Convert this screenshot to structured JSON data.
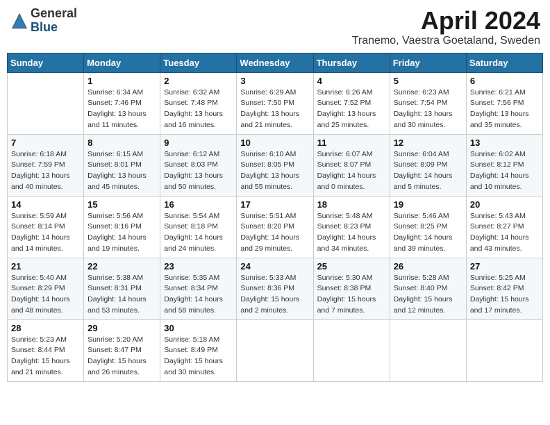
{
  "logo": {
    "general": "General",
    "blue": "Blue"
  },
  "title": "April 2024",
  "location": "Tranemo, Vaestra Goetaland, Sweden",
  "days_header": [
    "Sunday",
    "Monday",
    "Tuesday",
    "Wednesday",
    "Thursday",
    "Friday",
    "Saturday"
  ],
  "weeks": [
    [
      {
        "day": "",
        "info": ""
      },
      {
        "day": "1",
        "info": "Sunrise: 6:34 AM\nSunset: 7:46 PM\nDaylight: 13 hours\nand 11 minutes."
      },
      {
        "day": "2",
        "info": "Sunrise: 6:32 AM\nSunset: 7:48 PM\nDaylight: 13 hours\nand 16 minutes."
      },
      {
        "day": "3",
        "info": "Sunrise: 6:29 AM\nSunset: 7:50 PM\nDaylight: 13 hours\nand 21 minutes."
      },
      {
        "day": "4",
        "info": "Sunrise: 6:26 AM\nSunset: 7:52 PM\nDaylight: 13 hours\nand 25 minutes."
      },
      {
        "day": "5",
        "info": "Sunrise: 6:23 AM\nSunset: 7:54 PM\nDaylight: 13 hours\nand 30 minutes."
      },
      {
        "day": "6",
        "info": "Sunrise: 6:21 AM\nSunset: 7:56 PM\nDaylight: 13 hours\nand 35 minutes."
      }
    ],
    [
      {
        "day": "7",
        "info": "Sunrise: 6:18 AM\nSunset: 7:59 PM\nDaylight: 13 hours\nand 40 minutes."
      },
      {
        "day": "8",
        "info": "Sunrise: 6:15 AM\nSunset: 8:01 PM\nDaylight: 13 hours\nand 45 minutes."
      },
      {
        "day": "9",
        "info": "Sunrise: 6:12 AM\nSunset: 8:03 PM\nDaylight: 13 hours\nand 50 minutes."
      },
      {
        "day": "10",
        "info": "Sunrise: 6:10 AM\nSunset: 8:05 PM\nDaylight: 13 hours\nand 55 minutes."
      },
      {
        "day": "11",
        "info": "Sunrise: 6:07 AM\nSunset: 8:07 PM\nDaylight: 14 hours\nand 0 minutes."
      },
      {
        "day": "12",
        "info": "Sunrise: 6:04 AM\nSunset: 8:09 PM\nDaylight: 14 hours\nand 5 minutes."
      },
      {
        "day": "13",
        "info": "Sunrise: 6:02 AM\nSunset: 8:12 PM\nDaylight: 14 hours\nand 10 minutes."
      }
    ],
    [
      {
        "day": "14",
        "info": "Sunrise: 5:59 AM\nSunset: 8:14 PM\nDaylight: 14 hours\nand 14 minutes."
      },
      {
        "day": "15",
        "info": "Sunrise: 5:56 AM\nSunset: 8:16 PM\nDaylight: 14 hours\nand 19 minutes."
      },
      {
        "day": "16",
        "info": "Sunrise: 5:54 AM\nSunset: 8:18 PM\nDaylight: 14 hours\nand 24 minutes."
      },
      {
        "day": "17",
        "info": "Sunrise: 5:51 AM\nSunset: 8:20 PM\nDaylight: 14 hours\nand 29 minutes."
      },
      {
        "day": "18",
        "info": "Sunrise: 5:48 AM\nSunset: 8:23 PM\nDaylight: 14 hours\nand 34 minutes."
      },
      {
        "day": "19",
        "info": "Sunrise: 5:46 AM\nSunset: 8:25 PM\nDaylight: 14 hours\nand 39 minutes."
      },
      {
        "day": "20",
        "info": "Sunrise: 5:43 AM\nSunset: 8:27 PM\nDaylight: 14 hours\nand 43 minutes."
      }
    ],
    [
      {
        "day": "21",
        "info": "Sunrise: 5:40 AM\nSunset: 8:29 PM\nDaylight: 14 hours\nand 48 minutes."
      },
      {
        "day": "22",
        "info": "Sunrise: 5:38 AM\nSunset: 8:31 PM\nDaylight: 14 hours\nand 53 minutes."
      },
      {
        "day": "23",
        "info": "Sunrise: 5:35 AM\nSunset: 8:34 PM\nDaylight: 14 hours\nand 58 minutes."
      },
      {
        "day": "24",
        "info": "Sunrise: 5:33 AM\nSunset: 8:36 PM\nDaylight: 15 hours\nand 2 minutes."
      },
      {
        "day": "25",
        "info": "Sunrise: 5:30 AM\nSunset: 8:38 PM\nDaylight: 15 hours\nand 7 minutes."
      },
      {
        "day": "26",
        "info": "Sunrise: 5:28 AM\nSunset: 8:40 PM\nDaylight: 15 hours\nand 12 minutes."
      },
      {
        "day": "27",
        "info": "Sunrise: 5:25 AM\nSunset: 8:42 PM\nDaylight: 15 hours\nand 17 minutes."
      }
    ],
    [
      {
        "day": "28",
        "info": "Sunrise: 5:23 AM\nSunset: 8:44 PM\nDaylight: 15 hours\nand 21 minutes."
      },
      {
        "day": "29",
        "info": "Sunrise: 5:20 AM\nSunset: 8:47 PM\nDaylight: 15 hours\nand 26 minutes."
      },
      {
        "day": "30",
        "info": "Sunrise: 5:18 AM\nSunset: 8:49 PM\nDaylight: 15 hours\nand 30 minutes."
      },
      {
        "day": "",
        "info": ""
      },
      {
        "day": "",
        "info": ""
      },
      {
        "day": "",
        "info": ""
      },
      {
        "day": "",
        "info": ""
      }
    ]
  ]
}
